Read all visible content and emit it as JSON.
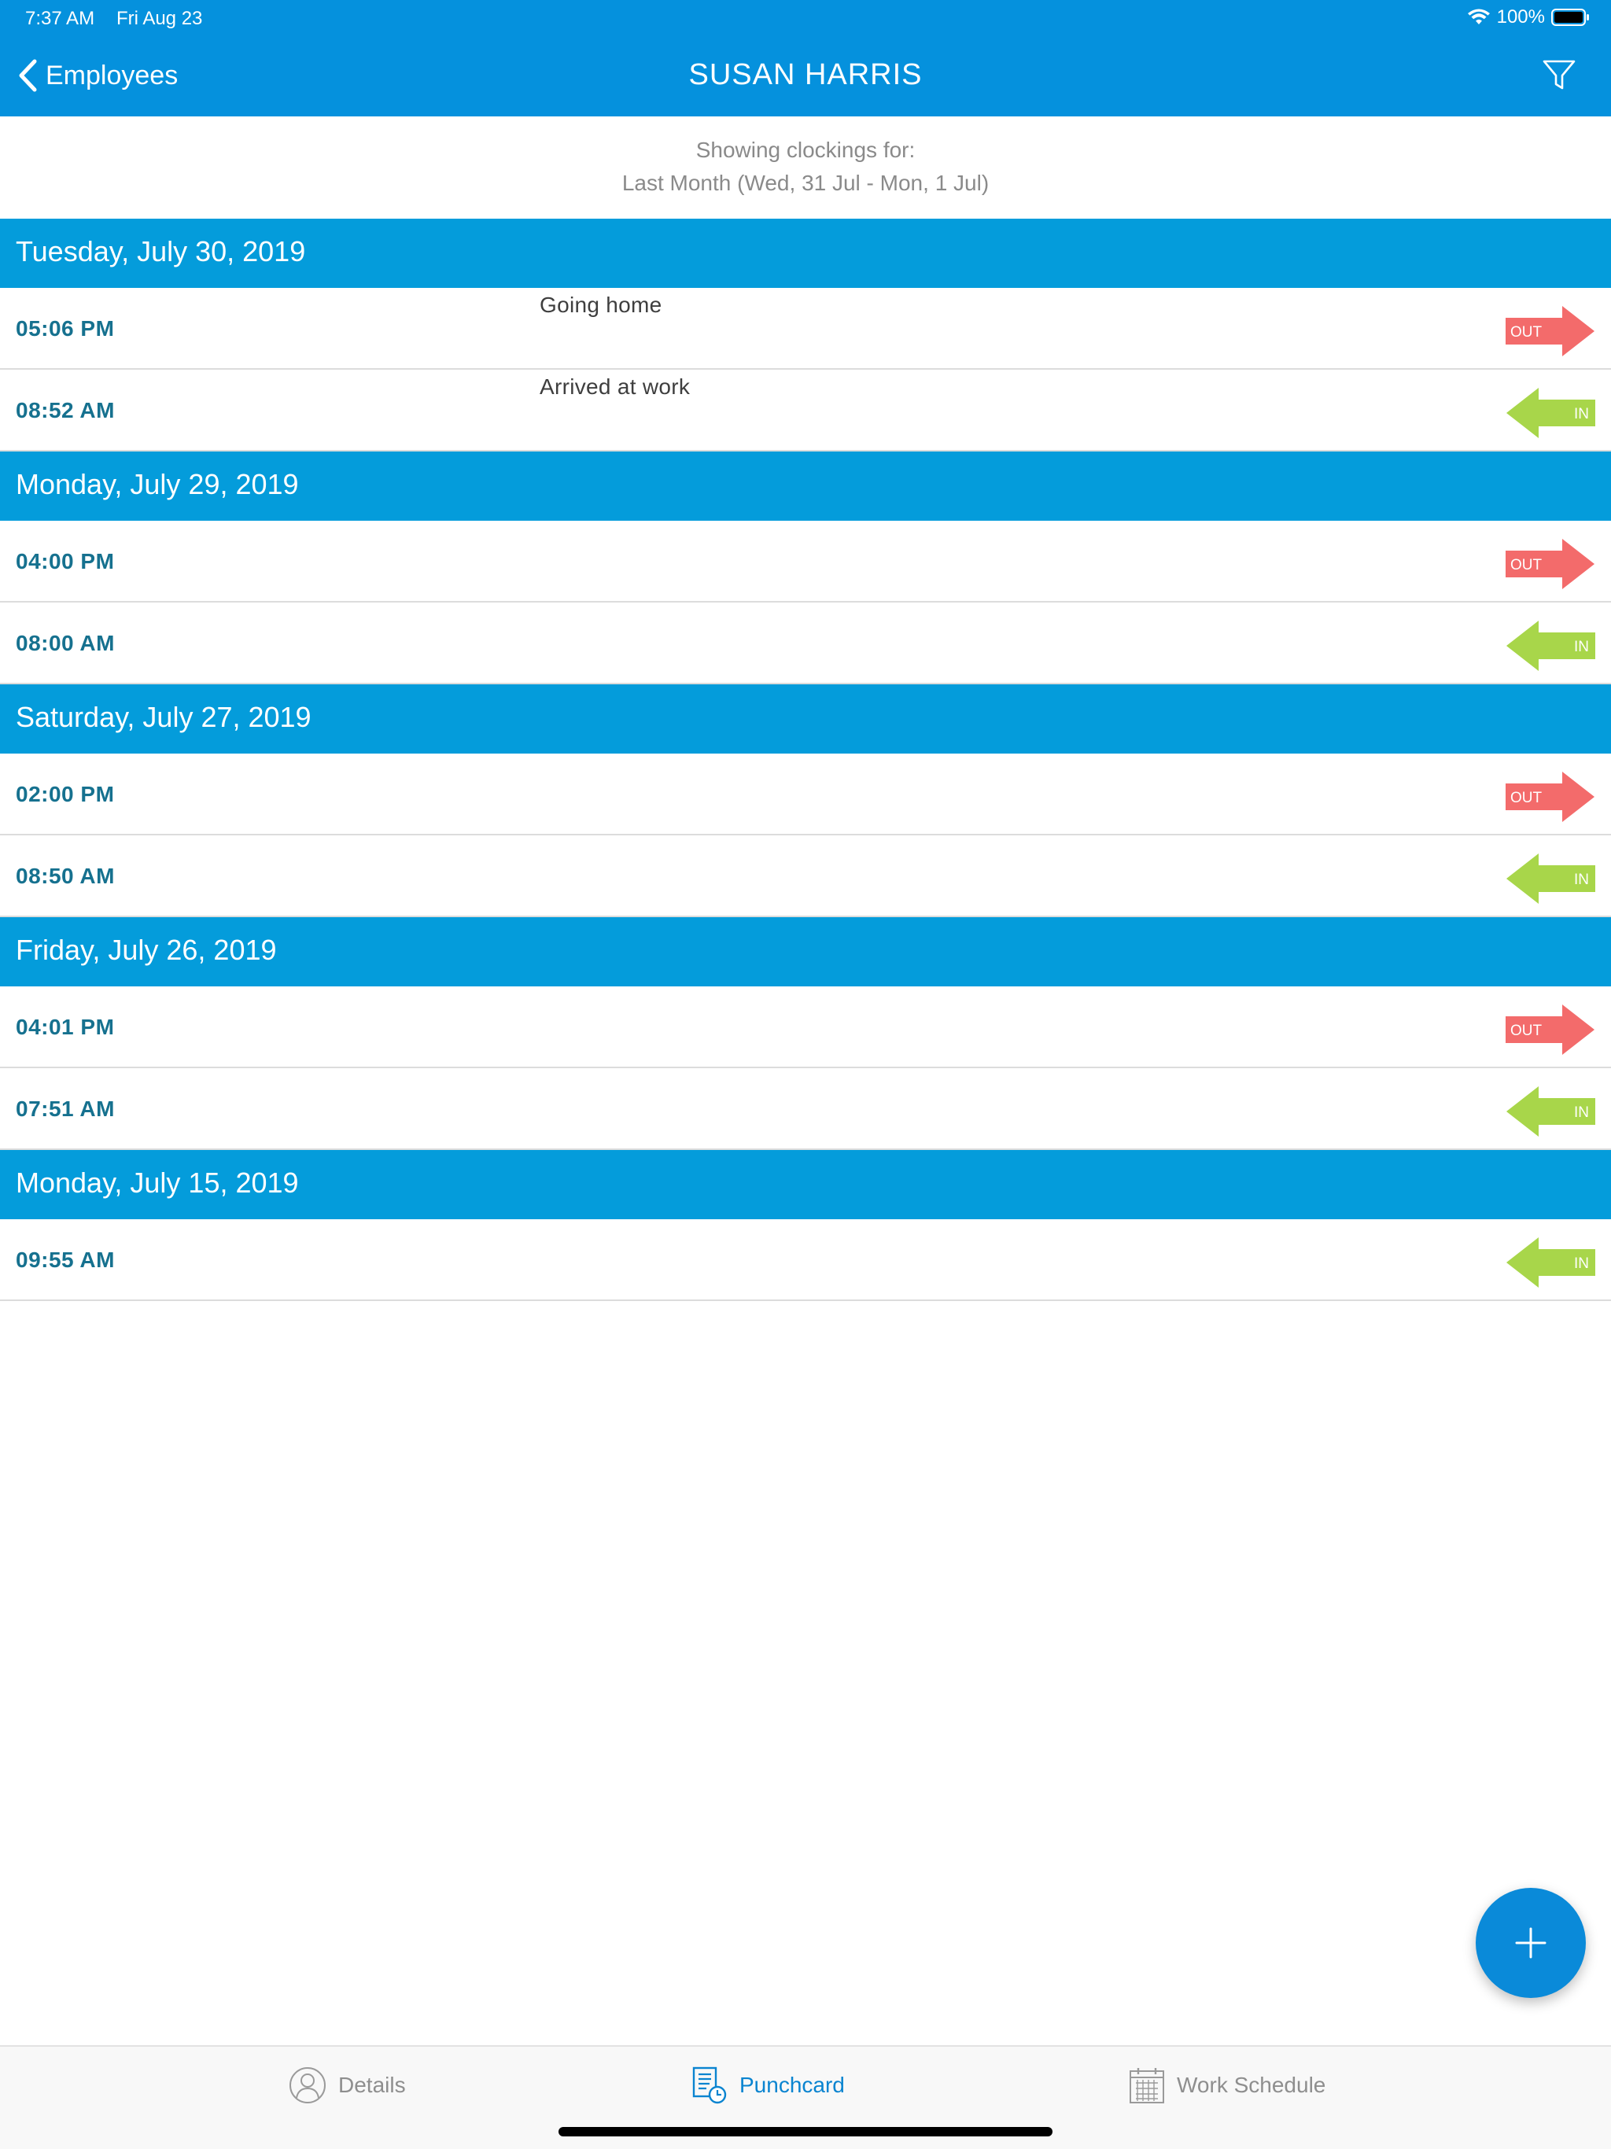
{
  "status_bar": {
    "time": "7:37 AM",
    "date": "Fri Aug 23",
    "battery_percent": "100%",
    "icons": [
      "wifi-icon",
      "battery-icon"
    ]
  },
  "nav": {
    "back_label": "Employees",
    "title": "SUSAN HARRIS",
    "filter_icon": "filter-icon"
  },
  "showing": {
    "line1": "Showing clockings for:",
    "line2": "Last Month (Wed, 31 Jul - Mon, 1 Jul)"
  },
  "days": [
    {
      "header": "Tuesday, July 30, 2019",
      "entries": [
        {
          "time": "05:06 PM",
          "note": "Going home",
          "direction": "OUT"
        },
        {
          "time": "08:52 AM",
          "note": "Arrived at work",
          "direction": "IN"
        }
      ]
    },
    {
      "header": "Monday, July 29, 2019",
      "entries": [
        {
          "time": "04:00 PM",
          "note": "",
          "direction": "OUT"
        },
        {
          "time": "08:00 AM",
          "note": "",
          "direction": "IN"
        }
      ]
    },
    {
      "header": "Saturday, July 27, 2019",
      "entries": [
        {
          "time": "02:00 PM",
          "note": "",
          "direction": "OUT"
        },
        {
          "time": "08:50 AM",
          "note": "",
          "direction": "IN"
        }
      ]
    },
    {
      "header": "Friday, July 26, 2019",
      "entries": [
        {
          "time": "04:01 PM",
          "note": "",
          "direction": "OUT"
        },
        {
          "time": "07:51 AM",
          "note": "",
          "direction": "IN"
        }
      ]
    },
    {
      "header": "Monday, July 15, 2019",
      "entries": [
        {
          "time": "09:55 AM",
          "note": "",
          "direction": "IN"
        }
      ]
    }
  ],
  "fab": {
    "icon": "plus-icon"
  },
  "tabs": [
    {
      "label": "Details",
      "icon": "person-icon",
      "active": false
    },
    {
      "label": "Punchcard",
      "icon": "punchcard-icon",
      "active": true
    },
    {
      "label": "Work Schedule",
      "icon": "calendar-icon",
      "active": false
    }
  ],
  "colors": {
    "nav_bar": "#0591dd",
    "day_header": "#049cdb",
    "time_text": "#16718f",
    "out_arrow": "#f36b6b",
    "in_arrow": "#a8d64a",
    "active_tab": "#0a84d0"
  }
}
